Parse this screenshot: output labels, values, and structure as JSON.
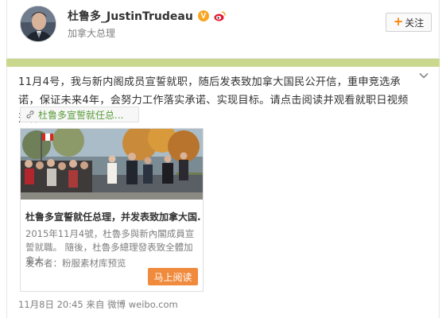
{
  "user": {
    "name": "杜鲁多_JustinTrudeau",
    "title": "加拿大总理",
    "verified_mark": "V",
    "avatar_icon": "user-avatar"
  },
  "follow_button": {
    "label": "关注",
    "icon": "plus-icon"
  },
  "post": {
    "text": "11月4号，我与新内阁成员宣誓就职，随后发表致加拿大国民公开信，重申竞选承诺，保证未来4年，会努力工作落实承诺、实现目标。请点击阅读并观看就职日视频选粹。",
    "link_tag": "杜鲁多宣誓就任总...",
    "card": {
      "title": "杜鲁多宣誓就任总理，并发表致加拿大国...",
      "description": "2015年11月4號，杜魯多與新內閣成員宣誓就職。 隨後，杜魯多總理發表致全體加拿大",
      "publisher": "发布者：粉服素材库预览",
      "read_button": "马上阅读"
    },
    "date": "11月8日 20:45",
    "source_prefix": "来自",
    "source": "微博 weibo.com"
  },
  "colors": {
    "accent_orange": "#f08a3c",
    "link_green": "#5a9c3a",
    "band_green": "#c9d88c",
    "verified_gold": "#f6a623"
  }
}
